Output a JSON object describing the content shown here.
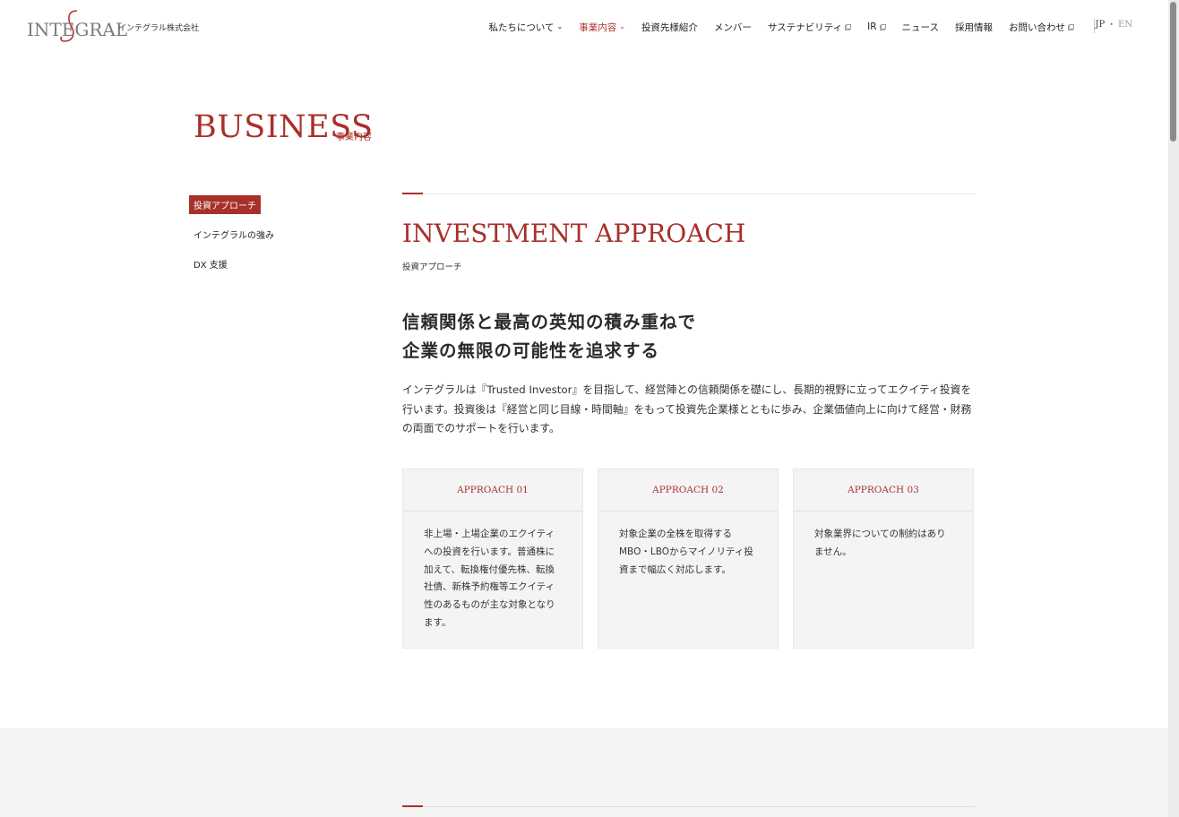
{
  "header": {
    "logo_text": "INTEGRAL",
    "company_name": "インテグラル株式会社",
    "nav": [
      {
        "label": "私たちについて",
        "chevron": true
      },
      {
        "label": "事業内容",
        "chevron": true,
        "active": true
      },
      {
        "label": "投資先様紹介"
      },
      {
        "label": "メンバー"
      },
      {
        "label": "サステナビリティ",
        "external": true
      },
      {
        "label": "IR",
        "external": true
      },
      {
        "label": "ニュース"
      },
      {
        "label": "採用情報"
      },
      {
        "label": "お問い合わせ",
        "external": true
      }
    ],
    "lang_jp": "JP",
    "lang_sep": "•",
    "lang_en": "EN"
  },
  "page": {
    "title": "BUSINESS",
    "subtitle": "事業内容"
  },
  "side_nav": [
    {
      "label": "投資アプローチ",
      "active": true
    },
    {
      "label": "インテグラルの強み"
    },
    {
      "label": "DX 支援"
    }
  ],
  "section": {
    "title": "INVESTMENT APPROACH",
    "subtitle": "投資アプローチ",
    "headline_line1": "信頼関係と最高の英知の積み重ねで",
    "headline_line2": "企業の無限の可能性を追求する",
    "body": "インテグラルは『Trusted Investor』を目指して、経営陣との信頼関係を礎にし、長期的視野に立ってエクイティ投資を行います。投資後は『経営と同じ目線・時間軸』をもって投資先企業様とともに歩み、企業価値向上に向けて経営・財務の両面でのサポートを行います。"
  },
  "cards": [
    {
      "title": "APPROACH 01",
      "text": "非上場・上場企業のエクイティへの投資を行います。普通株に加えて、転換権付優先株、転換社債、新株予約権等エクイティ性のあるものが主な対象となります。"
    },
    {
      "title": "APPROACH 02",
      "text": "対象企業の全株を取得するMBO・LBOからマイノリティ投資まで幅広く対応します。"
    },
    {
      "title": "APPROACH 03",
      "text": "対象業界についての制約はありません。"
    }
  ],
  "colors": {
    "accent": "#a8302b",
    "card_bg": "#f4f4f4"
  }
}
